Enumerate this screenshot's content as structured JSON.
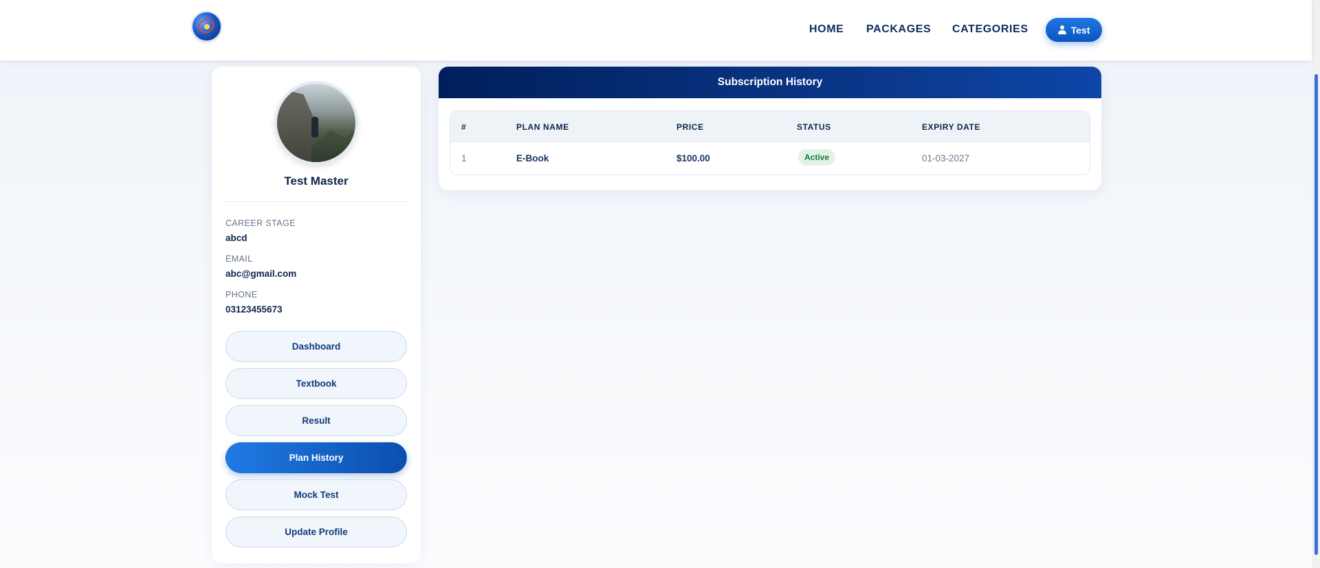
{
  "navbar": {
    "links": [
      "HOME",
      "PACKAGES",
      "CATEGORIES"
    ],
    "user_button": "Test"
  },
  "profile": {
    "name": "Test Master",
    "fields": [
      {
        "label": "CAREER STAGE",
        "value": "abcd"
      },
      {
        "label": "EMAIL",
        "value": "abc@gmail.com"
      },
      {
        "label": "PHONE",
        "value": "03123455673"
      }
    ],
    "menu": [
      {
        "label": "Dashboard",
        "active": false
      },
      {
        "label": "Textbook",
        "active": false
      },
      {
        "label": "Result",
        "active": false
      },
      {
        "label": "Plan History",
        "active": true
      },
      {
        "label": "Mock Test",
        "active": false
      },
      {
        "label": "Update Profile",
        "active": false
      }
    ]
  },
  "history": {
    "title": "Subscription History",
    "columns": [
      "#",
      "PLAN NAME",
      "PRICE",
      "STATUS",
      "EXPIRY DATE"
    ],
    "rows": [
      {
        "index": "1",
        "plan": "E-Book",
        "price": "$100.00",
        "status": "Active",
        "expiry": "01-03-2027"
      }
    ]
  },
  "colors": {
    "accent": "#1f77e0",
    "header_dark": "#001f5c",
    "status_active_bg": "#e1f3e6",
    "status_active_text": "#1a7a3b"
  },
  "icons": [
    "logo",
    "user-icon"
  ]
}
